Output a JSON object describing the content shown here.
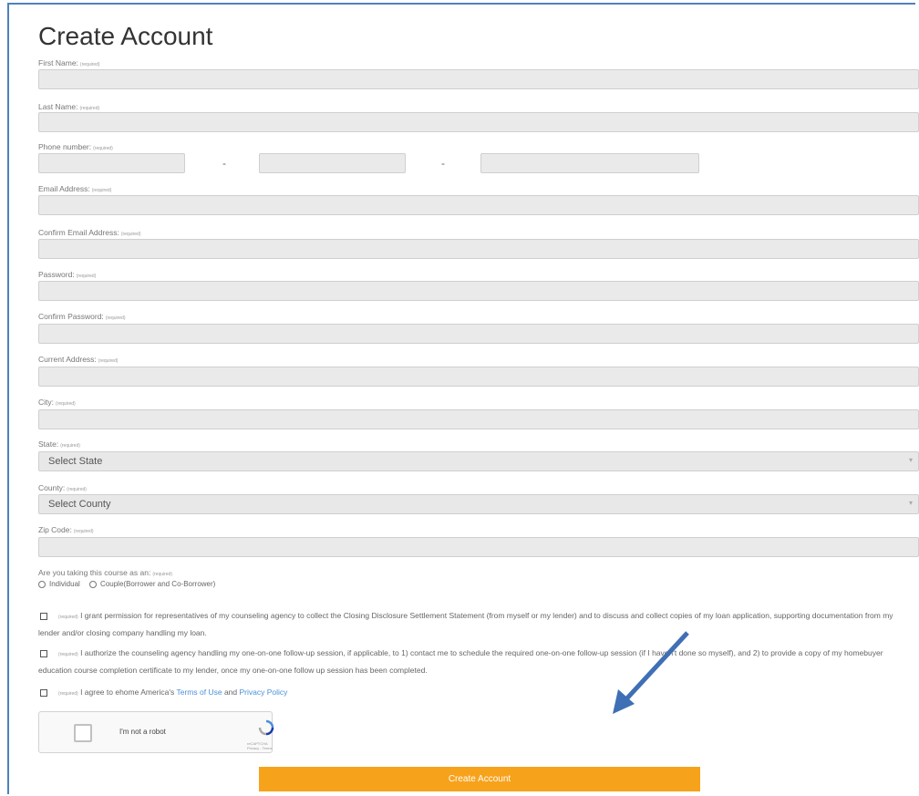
{
  "form": {
    "title": "Create Account",
    "required_tag": "(required)",
    "labels": {
      "first_name": "First Name:",
      "last_name": "Last Name:",
      "phone": "Phone number:",
      "email": "Email Address:",
      "confirm_email": "Confirm Email Address:",
      "password": "Password:",
      "confirm_password": "Confirm Password:",
      "address": "Current Address:",
      "city": "City:",
      "state": "State:",
      "county": "County:",
      "zip": "Zip Code:",
      "course_as": "Are you taking this course as an:"
    },
    "phone_separator": "-",
    "state_select": "Select State",
    "county_select": "Select County",
    "radio_options": [
      "Individual",
      "Couple(Borrower and Co-Borrower)"
    ],
    "consent_1": "I grant permission for representatives of my counseling agency to collect the Closing Disclosure Settlement Statement (from myself or my lender) and to discuss and collect copies of my loan application, supporting documentation from my lender and/or closing company handling my loan.",
    "consent_2": "I authorize the counseling agency handling my one-on-one follow-up session, if applicable, to 1) contact me to schedule the required one-on-one follow-up session (if I haven't done so myself), and 2) to provide a copy of my homebuyer education course completion certificate to my lender, once my one-on-one follow up session has been completed.",
    "consent_3_prefix": "I agree to ehome America's",
    "consent_3_terms": "Terms of Use",
    "consent_3_and": "and",
    "consent_3_privacy": "Privacy Policy",
    "captcha_text": "I'm not a robot",
    "captcha_brand": "reCAPTCHA",
    "captcha_links": "Privacy - Terms",
    "submit": "Create Account"
  },
  "colors": {
    "button": "#f7a21b",
    "link": "#4a90d9",
    "arrow": "#3f6fb5"
  },
  "icons": {
    "select_caret": "caret-down-icon",
    "captcha_logo": "recaptcha-logo-icon",
    "annotation": "arrow-icon"
  }
}
